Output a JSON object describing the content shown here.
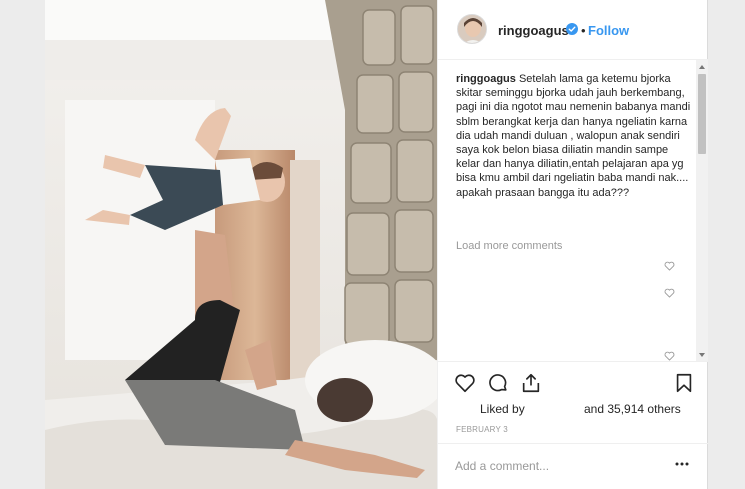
{
  "header": {
    "username": "ringgoagus",
    "verified_icon": "verified-badge-icon",
    "separator": "•",
    "follow_label": "Follow"
  },
  "caption": {
    "username": "ringgoagus",
    "text": "Setelah lama ga ketemu bjorka skitar seminggu bjorka udah jauh berkembang, pagi ini dia ngotot mau nemenin babanya mandi sblm berangkat kerja dan hanya ngeliatin karna dia udah mandi duluan , walopun anak sendiri saya kok belon biasa diliatin mandin sampe kelar dan hanya diliatin,entah pelajaran apa yg bisa kmu ambil dari ngeliatin baba mandi nak.... apakah prasaan bangga itu ada???"
  },
  "load_more_label": "Load more comments",
  "actions": {
    "like_icon": "heart-icon",
    "comment_icon": "comment-icon",
    "share_icon": "share-icon",
    "save_icon": "bookmark-icon"
  },
  "likes": {
    "liked_by_label": "Liked by",
    "others_label": "and 35,914 others"
  },
  "date": "FEBRUARY 3",
  "add_comment": {
    "placeholder": "Add a comment..."
  },
  "colors": {
    "link": "#3897f0",
    "muted": "#999999",
    "text": "#262626",
    "border": "#efefef"
  }
}
